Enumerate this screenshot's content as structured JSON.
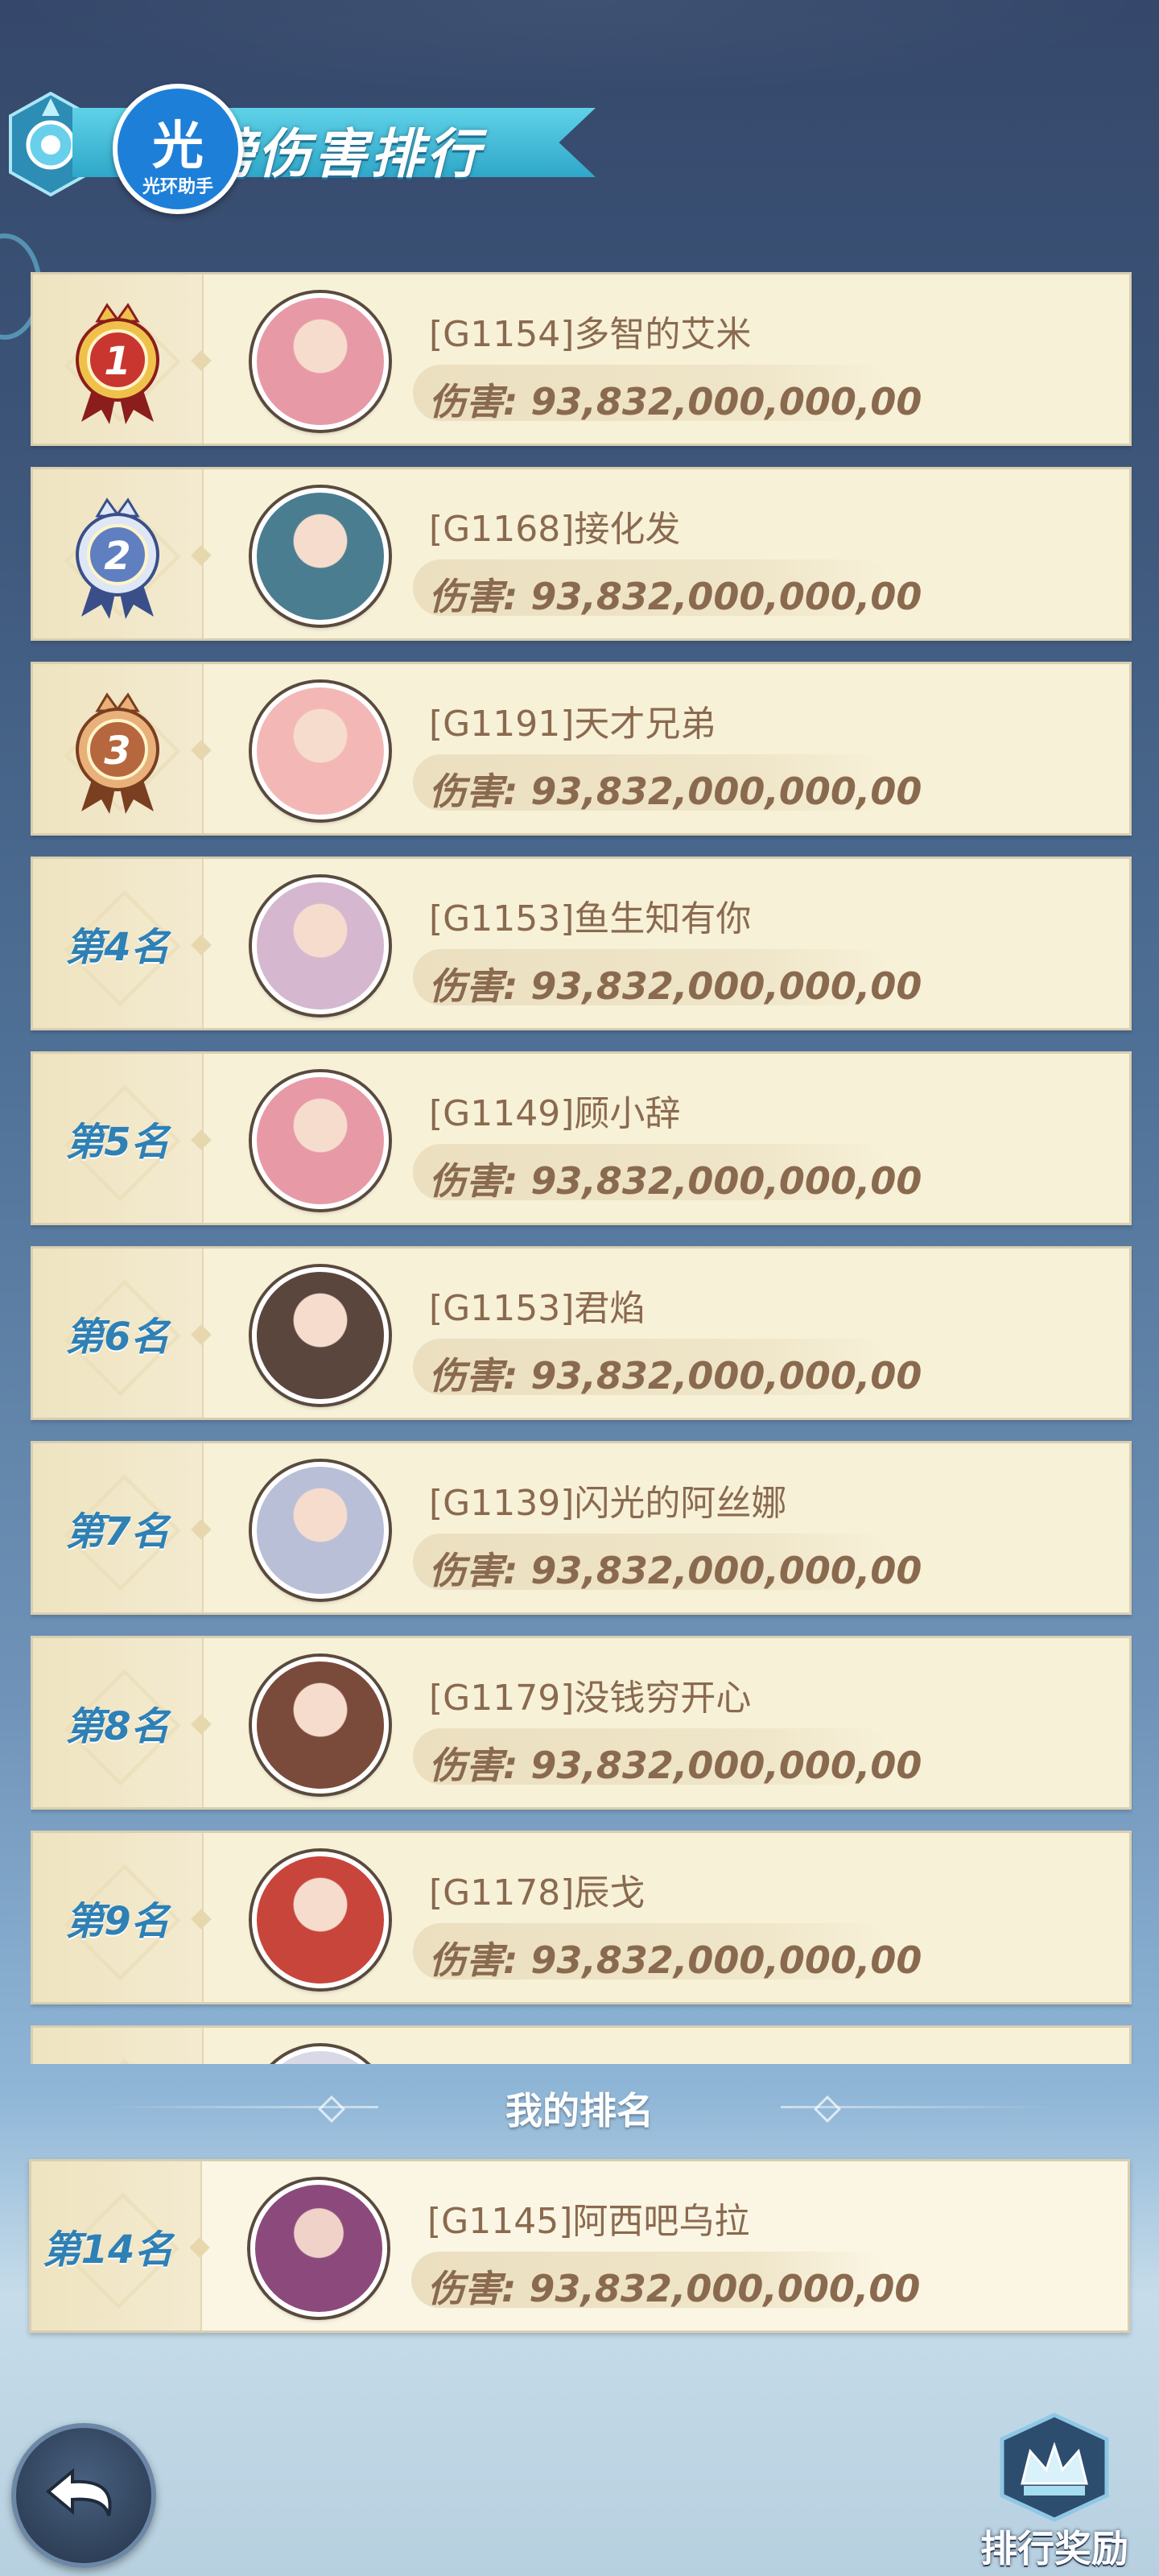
{
  "header": {
    "title": "榜伤害排行",
    "logo_main": "光",
    "logo_sub": "光环助手"
  },
  "rankings": [
    {
      "rank_label": "",
      "medal": "1",
      "name": "[G1154]多智的艾米",
      "damage": "伤害: 93,832,000,000,00",
      "avatar_color": "#e79aa6"
    },
    {
      "rank_label": "",
      "medal": "2",
      "name": "[G1168]接化发",
      "damage": "伤害: 93,832,000,000,00",
      "avatar_color": "#4a7d8f"
    },
    {
      "rank_label": "",
      "medal": "3",
      "name": "[G1191]天才兄弟",
      "damage": "伤害: 93,832,000,000,00",
      "avatar_color": "#f3b8b6"
    },
    {
      "rank_label": "第4名",
      "medal": "",
      "name": "[G1153]鱼生知有你",
      "damage": "伤害: 93,832,000,000,00",
      "avatar_color": "#d5b7d0"
    },
    {
      "rank_label": "第5名",
      "medal": "",
      "name": "[G1149]顾小辞",
      "damage": "伤害: 93,832,000,000,00",
      "avatar_color": "#e79aa6"
    },
    {
      "rank_label": "第6名",
      "medal": "",
      "name": "[G1153]君焰",
      "damage": "伤害: 93,832,000,000,00",
      "avatar_color": "#5b463d"
    },
    {
      "rank_label": "第7名",
      "medal": "",
      "name": "[G1139]闪光的阿丝娜",
      "damage": "伤害: 93,832,000,000,00",
      "avatar_color": "#b9bfd6"
    },
    {
      "rank_label": "第8名",
      "medal": "",
      "name": "[G1179]没钱穷开心",
      "damage": "伤害: 93,832,000,000,00",
      "avatar_color": "#7a4a3a"
    },
    {
      "rank_label": "第9名",
      "medal": "",
      "name": "[G1178]辰戈",
      "damage": "伤害: 93,832,000,000,00",
      "avatar_color": "#c8453c"
    }
  ],
  "my_rank": {
    "section_title": "我的排名",
    "rank_label": "第14名",
    "name": "[G1145]阿西吧乌拉",
    "damage": "伤害: 93,832,000,000,00",
    "avatar_color": "#8c4a7c"
  },
  "buttons": {
    "reward_label": "排行奖励"
  },
  "colors": {
    "row_bg": "#f7f1d8",
    "rank_text": "#2e80b5",
    "name_text": "#8a6a4f",
    "banner": "#46bcd9"
  }
}
